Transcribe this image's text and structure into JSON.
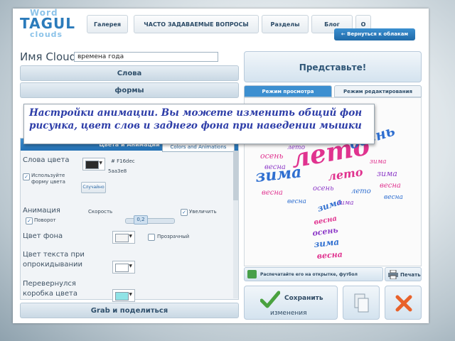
{
  "logo": {
    "top": "Word",
    "main": "TAGUL",
    "bottom": "clouds"
  },
  "nav": {
    "tabs": [
      "Галерея",
      "ЧАСТО ЗАДАВАЕМЫЕ ВОПРОСЫ",
      "Разделы",
      "Блог",
      "О"
    ],
    "back_label": "← Вернуться к облакам"
  },
  "name": {
    "label": "Имя Cloud:",
    "value": "времена года"
  },
  "sections": {
    "words": "Слова",
    "shapes": "формы",
    "grab": "Grab и поделиться"
  },
  "colors_panel": {
    "title": "Цвета и Анимации",
    "tooltip": "Colors and Animations",
    "word_colors": "Слова цвета",
    "use_shape_color": "Используйте форму цвета",
    "hex1": "# F16dec",
    "hex2": "5aa3e8",
    "random": "Случайно",
    "animation": "Анимация",
    "speed_label": "Скорость",
    "speed_value": "0,2",
    "increase": "Увеличить",
    "rotate": "Поворот",
    "bg_color": "Цвет фона",
    "transparent": "Прозрачный",
    "hover_text_color": "Цвет текста при опрокидывании",
    "flipped_box": "Перевернулся коробка цвета"
  },
  "right": {
    "imagine": "Представьте!",
    "tab_preview": "Режим просмотра",
    "tab_edit": "Режим редактирования",
    "print_bar": "Распечатайте его на открытке, футбол",
    "print": "Печать",
    "save": "Сохранить",
    "save_sub": "изменения"
  },
  "cloud_words": [
    "лето",
    "осень",
    "зима",
    "весна",
    "лето",
    "осень",
    "весна",
    "зима",
    "весна",
    "лето",
    "зима",
    "осень",
    "весна",
    "лето",
    "зима",
    "весна",
    "осень",
    "зима",
    "весна",
    "зима",
    "весна"
  ],
  "callout": "Настройки анимации. Вы можете изменить общий фон рисунка, цвет слов и заднего фона при наведении мышки",
  "colors": {
    "accent": "#2472b4",
    "callout_text": "#2d3da8",
    "cloud_pink": "#e0338f",
    "cloud_blue": "#2f6fd0",
    "cloud_purple": "#8d3ac8"
  }
}
